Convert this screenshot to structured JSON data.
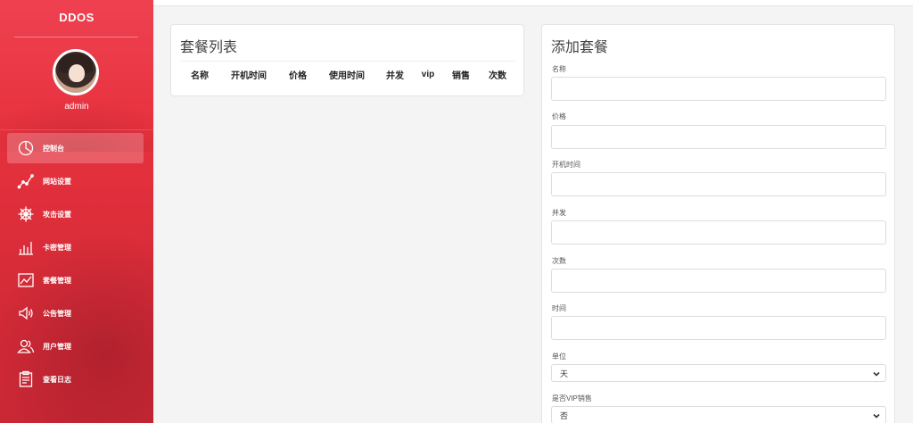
{
  "sidebar": {
    "brand": "DDOS",
    "username": "admin",
    "items": [
      {
        "label": "控制台",
        "icon": "pie-chart-icon",
        "active": true
      },
      {
        "label": "网站设置",
        "icon": "line-graph-icon",
        "active": false
      },
      {
        "label": "攻击设置",
        "icon": "ship-wheel-icon",
        "active": false
      },
      {
        "label": "卡密管理",
        "icon": "bar-chart-icon",
        "active": false
      },
      {
        "label": "套餐管理",
        "icon": "trend-chart-icon",
        "active": false
      },
      {
        "label": "公告管理",
        "icon": "speaker-icon",
        "active": false
      },
      {
        "label": "用户管理",
        "icon": "users-icon",
        "active": false
      },
      {
        "label": "查看日志",
        "icon": "clipboard-icon",
        "active": false
      }
    ]
  },
  "package_list": {
    "title": "套餐列表",
    "columns": [
      "名称",
      "开机时间",
      "价格",
      "使用时间",
      "并发",
      "vip",
      "销售",
      "次数"
    ]
  },
  "add_package": {
    "title": "添加套餐",
    "fields": {
      "name": {
        "label": "名称",
        "value": ""
      },
      "price": {
        "label": "价格",
        "value": ""
      },
      "boot_time": {
        "label": "开机时间",
        "value": ""
      },
      "concurrency": {
        "label": "并发",
        "value": ""
      },
      "count": {
        "label": "次数",
        "value": ""
      },
      "time": {
        "label": "时间",
        "value": ""
      },
      "unit": {
        "label": "单位",
        "value": "天"
      },
      "vip_sale": {
        "label": "是否VIP销售",
        "value": "否"
      }
    }
  },
  "colors": {
    "sidebar": "#e8323f",
    "accent": "#ffffff"
  }
}
